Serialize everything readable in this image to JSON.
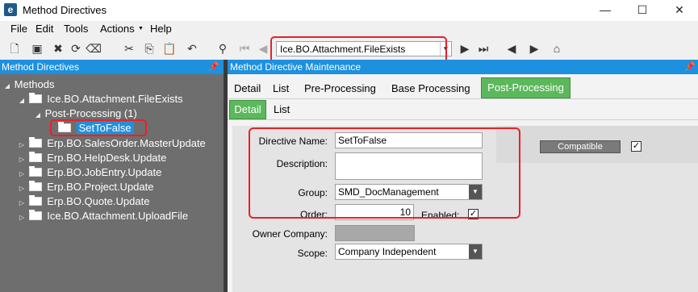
{
  "window": {
    "title": "Method Directives",
    "minimize": "—",
    "maximize": "☐",
    "close": "✕"
  },
  "menu": [
    "File",
    "Edit",
    "Tools",
    "Actions",
    "Help"
  ],
  "toolbar": {
    "method_value": "Ice.BO.Attachment.FileExists"
  },
  "left_panel": {
    "header": "Method Directives",
    "tree": {
      "root": "Methods",
      "item1": "Ice.BO.Attachment.FileExists",
      "child": "Post-Processing (1)",
      "grandchild": "SetToFalse",
      "item2": "Erp.BO.SalesOrder.MasterUpdate",
      "item3": "Erp.BO.HelpDesk.Update",
      "item4": "Erp.BO.JobEntry.Update",
      "item5": "Erp.BO.Project.Update",
      "item6": "Erp.BO.Quote.Update",
      "item7": "Ice.BO.Attachment.UploadFile"
    }
  },
  "right_panel": {
    "header": "Method Directive Maintenance",
    "tabs": [
      "Detail",
      "List",
      "Pre-Processing",
      "Base Processing",
      "Post-Processing"
    ],
    "subtabs": [
      "Detail",
      "List"
    ]
  },
  "form": {
    "directive_name_label": "Directive Name:",
    "directive_name_value": "SetToFalse",
    "description_label": "Description:",
    "description_value": "",
    "group_label": "Group:",
    "group_value": "SMD_DocManagement",
    "order_label": "Order:",
    "order_value": "10",
    "enabled_label": "Enabled:",
    "owner_label": "Owner Company:",
    "scope_label": "Scope:",
    "scope_value": "Company Independent",
    "compatible_label": "Compatible",
    "check_glyph": "✓"
  },
  "accent_colors": {
    "header_blue": "#1e90e0",
    "tab_green": "#5cb85c",
    "highlight_red": "#e8202a"
  }
}
